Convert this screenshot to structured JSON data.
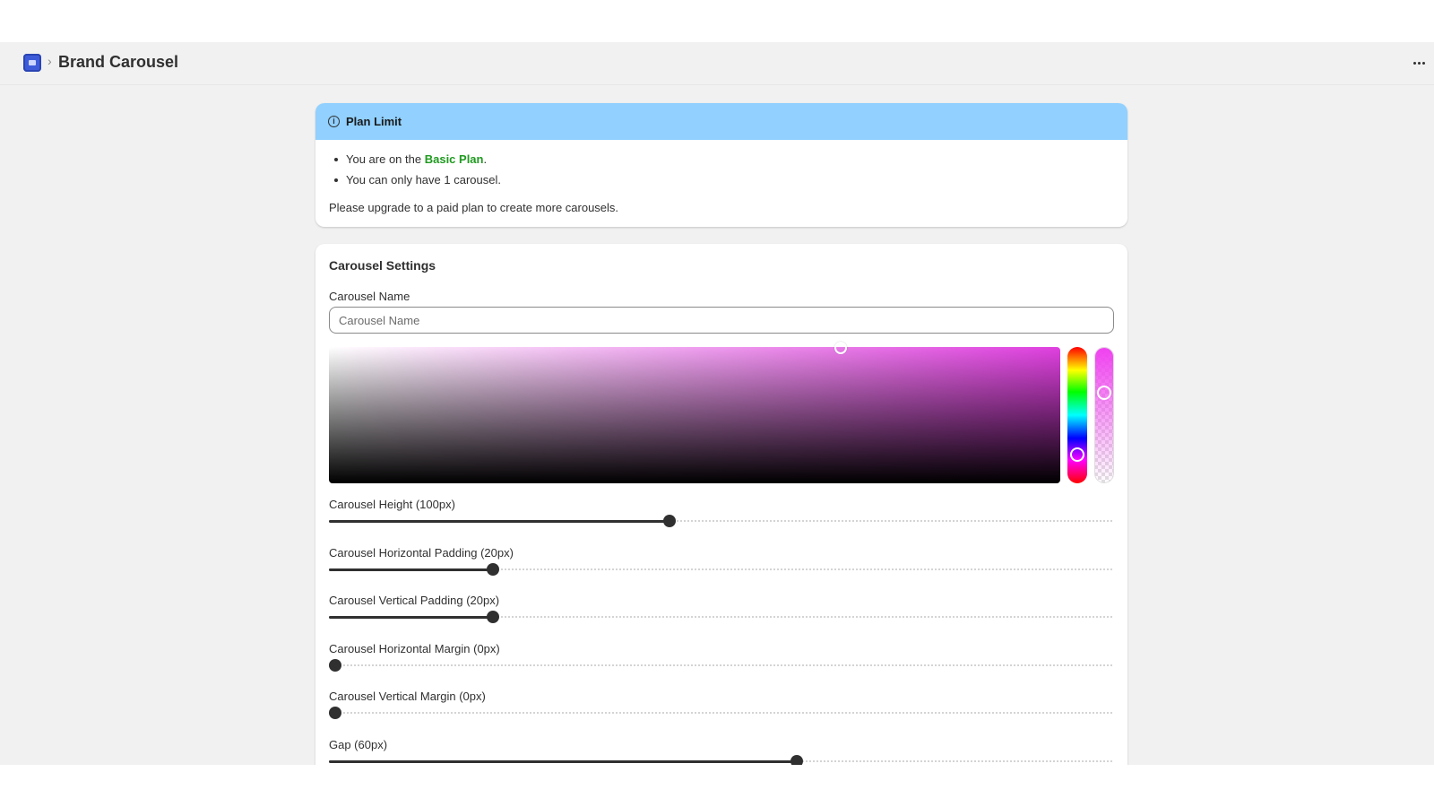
{
  "header": {
    "breadcrumb_separator": "›",
    "title": "Brand Carousel",
    "more_icon": "more-horizontal-icon"
  },
  "banner": {
    "title": "Plan Limit",
    "icon": "info-icon",
    "line1_prefix": "You are on the ",
    "plan_name": "Basic Plan",
    "line1_suffix": ".",
    "line2": "You can only have 1 carousel.",
    "note": "Please upgrade to a paid plan to create more carousels.",
    "accent_color": "#91d0ff",
    "plan_color": "#1f9a1f"
  },
  "settings": {
    "title": "Carousel Settings",
    "name_label": "Carousel Name",
    "name_value": "",
    "name_placeholder": "Carousel Name",
    "color_picker": {
      "hue_color": "#e040e0",
      "saturation_fraction": 0.7,
      "brightness_fraction": 1.0,
      "hue_fraction": 0.78,
      "alpha_fraction": 0.3
    },
    "sliders": [
      {
        "label": "Carousel Height (100px)",
        "value_fraction": 0.433
      },
      {
        "label": "Carousel Horizontal Padding (20px)",
        "value_fraction": 0.204
      },
      {
        "label": "Carousel Vertical Padding (20px)",
        "value_fraction": 0.204
      },
      {
        "label": "Carousel Horizontal Margin (0px)",
        "value_fraction": 0.0
      },
      {
        "label": "Carousel Vertical Margin (0px)",
        "value_fraction": 0.0
      },
      {
        "label": "Gap (60px)",
        "value_fraction": 0.597
      }
    ]
  }
}
